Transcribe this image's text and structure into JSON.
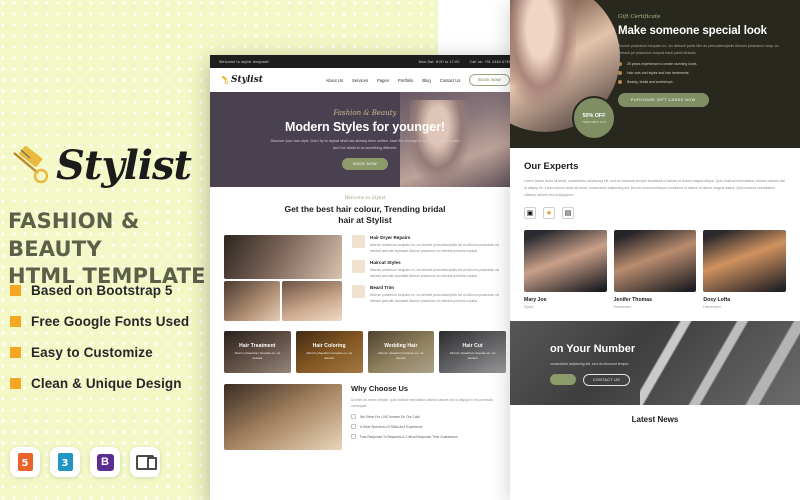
{
  "promo": {
    "brand": "Stylist",
    "title": "FASHION & BEAUTY\nHTML TEMPLATE",
    "title_line1": "FASHION & BEAUTY",
    "title_line2": "HTML TEMPLATE",
    "features": [
      "Based on Bootstrap 5",
      "Free Google Fonts Used",
      "Easy to Customize",
      "Clean & Unique Design"
    ],
    "badges": [
      {
        "name": "html5-badge",
        "label": "5"
      },
      {
        "name": "css3-badge",
        "label": "3"
      },
      {
        "name": "bootstrap-badge",
        "label": "B"
      },
      {
        "name": "responsive-badge",
        "label": ""
      }
    ],
    "accent_color": "#f5a623",
    "background_color": "#f3f8c6"
  },
  "mock": {
    "topbar": {
      "welcome": "Welcome to stylist template!",
      "hours": "Mon-Sat: 8:00 to 17:00",
      "phone": "Call us: +91 2464 6789"
    },
    "nav": {
      "logo": "Stylist",
      "items": [
        "About Us",
        "Services",
        "Pages",
        "Portfolio",
        "Blog",
        "Contact Us"
      ],
      "cta": "BOOK NOW"
    },
    "hero": {
      "eyebrow": "Fashion & Beauty",
      "title": "Modern Styles for younger!",
      "desc": "Discover your own style. Don't try to repeat what has already been written, have the courage to say your own thing and don't be afraid to do something different.",
      "button": "BOOK NOW"
    },
    "about": {
      "eyebrow": "Welcome to Stylist",
      "title_line1": "Get the best hair colour, Trending bridal",
      "title_line2": "hair at Stylist",
      "services": [
        {
          "name": "Hair Dryer Repairs",
          "desc": "Aliorum phaedrum torquato eu, vix detraxit periculaeuripidis his an Aliorum phaedrum vix detraxit periculis cupidatat Aliorum phaedrum vix detraxit periculis cupidat."
        },
        {
          "name": "Haircut Styles",
          "desc": "Aliorum phaedrum torquato eu, vix detraxit periculaeuripidis his an Aliorum phaedrum vix detraxit periculis cupidatat Aliorum phaedrum vix detraxit periculis cupidat."
        },
        {
          "name": "Beard Trim",
          "desc": "Aliorum phaedrum torquato eu, vix detraxit periculaeuripidis his an Aliorum phaedrum vix detraxit periculis cupidatat Aliorum phaedrum vix detraxit periculis cupidat."
        }
      ]
    },
    "cards": [
      {
        "title": "Hair Treatment",
        "sub": "Aliorum phaedrum torquato eu, vix detraxit"
      },
      {
        "title": "Hair Coloring",
        "sub": "Aliorum phaedrum torquato eu, vix detraxit"
      },
      {
        "title": "Wedding Hair",
        "sub": "Aliorum phaedrum torquato eu, vix detraxit"
      },
      {
        "title": "Hair Cut",
        "sub": "Aliorum phaedrum torquato eu, vix detraxit"
      }
    ],
    "why": {
      "title": "Why Choose Us",
      "desc": "Ut enim ad minim veniam, quis nostrud exercitation ullamco laboris nisi ut aliquip ex ea commodo consequat.",
      "items": [
        "We Strive For LIVE Answer On Our Calls",
        "A Wide Spectrum Of Skills And Experience",
        "Fast Response To Requests & Critical Response Time Guaranteed"
      ]
    }
  },
  "right": {
    "gift": {
      "eyebrow": "Gift Certificate",
      "title": "Make someone special look",
      "desc": "Aliorum phaedrum torquato eu, vix detraxit pariis Mei an periculaeuripidis Aliorum phaedrum torqu vix detraxit pe phaedrum torquat tranil pariis Mricutis.",
      "bullets": [
        "25 years experience to create stunning looks",
        "Hair cuts and styles and hair treatments",
        "Beauty, bridal and workshops"
      ],
      "button": "PURCHASE GIFT CARDS NOW",
      "badge_value": "50% OFF",
      "badge_label": "YOUR NEXT CUT"
    },
    "experts": {
      "title": "Our Experts",
      "desc": "Lorem ipsum dolor sit amet, consectetur adipiscing elit, sed do eiusmod tempor incididunt ut labore et dolore magna aliqua. Quis nostrud exercitation ullamco laboris nisi ut aliquip ex. Lorem ipsum dolor sit amet, consectetur adipiscing elit, sed do eiusmod tempor incididunt ut labore et dolore magna aliqua. Quis nostrud exercitation ullamco laboris nisi ut aliquip ex.",
      "icons": [
        "certificate-icon",
        "award-icon",
        "document-icon"
      ],
      "members": [
        {
          "name": "Mary Joe",
          "role": "Stylist"
        },
        {
          "name": "Jenifer Thomas",
          "role": "Hairdresser"
        },
        {
          "name": "Dosy Lofta",
          "role": "Hairdresser"
        }
      ]
    },
    "cta": {
      "title": "on Your Number",
      "desc": "consectetur adipiscing elit, sed do eiusmod tempor",
      "button": "CONTACT US"
    },
    "news": {
      "title": "Latest News"
    }
  }
}
